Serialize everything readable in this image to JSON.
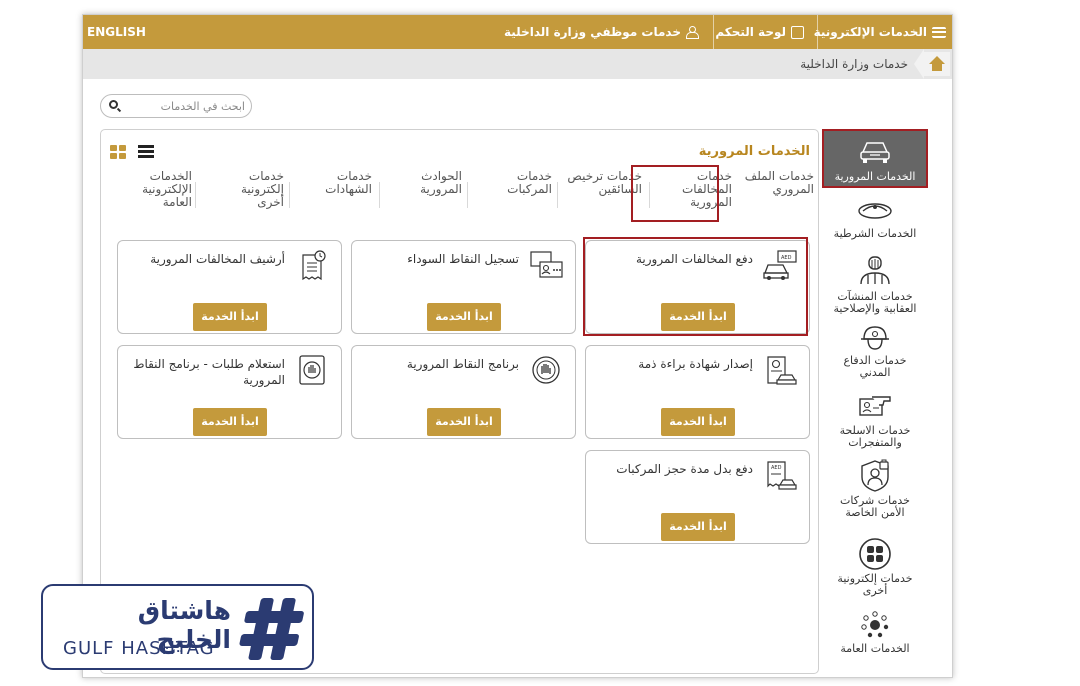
{
  "topbar": {
    "eservices": "الخدمات الإلكترونية",
    "dashboard": "لوحة التحكم",
    "employee_services": "خدمات موظفي وزارة الداخلية",
    "language": "ENGLISH"
  },
  "breadcrumb": {
    "current": "خدمات وزارة الداخلية"
  },
  "search": {
    "placeholder": "ابحث في الخدمات"
  },
  "section": {
    "title": "الخدمات المرورية"
  },
  "tabs": [
    {
      "label": "خدمات الملف\nالمروري"
    },
    {
      "label": "خدمات\nالمخالفات\nالمرورية"
    },
    {
      "label": "خدمات ترخيص\nالسائقين"
    },
    {
      "label": "خدمات\nالمركبات"
    },
    {
      "label": "الحوادث\nالمرورية"
    },
    {
      "label": "خدمات\nالشهادات"
    },
    {
      "label": "خدمات\nإلكترونية\nأخرى"
    },
    {
      "label": "الخدمات\nالإلكترونية\nالعامة"
    }
  ],
  "cards": [
    {
      "title": "دفع المخالفات المرورية",
      "button": "ابدأ الخدمة",
      "icon": "car-fine-icon"
    },
    {
      "title": "تسجيل النقاط السوداء",
      "button": "ابدأ الخدمة",
      "icon": "id-cards-icon"
    },
    {
      "title": "أرشيف المخالفات المرورية",
      "button": "ابدأ الخدمة",
      "icon": "archive-receipt-icon"
    },
    {
      "title": "إصدار شهادة براءة ذمة",
      "button": "ابدأ الخدمة",
      "icon": "clearance-certificate-icon"
    },
    {
      "title": "برنامج النقاط المرورية",
      "button": "ابدأ الخدمة",
      "icon": "hand-points-icon"
    },
    {
      "title": "استعلام طلبات - برنامج النقاط المرورية",
      "button": "ابدأ الخدمة",
      "icon": "inquiry-points-icon"
    },
    {
      "title": "دفع بدل مدة حجز المركبات",
      "button": "ابدأ الخدمة",
      "icon": "impound-fee-icon"
    }
  ],
  "sidebar": [
    {
      "label": "الخدمات المرورية",
      "icon": "car-icon",
      "active": true
    },
    {
      "label": "الخدمات الشرطية",
      "icon": "police-cap-icon"
    },
    {
      "label": "خدمات المنشآت\nالعقابية والإصلاحية",
      "icon": "prison-icon"
    },
    {
      "label": "خدمات الدفاع\nالمدني",
      "icon": "firefighter-icon"
    },
    {
      "label": "خدمات الاسلحة\nوالمتفجرات",
      "icon": "weapons-license-icon"
    },
    {
      "label": "خدمات شركات\nالأمن الخاصة",
      "icon": "security-guard-icon"
    },
    {
      "label": "خدمات إلكترونية\nأخرى",
      "icon": "other-services-icon"
    },
    {
      "label": "الخدمات العامة",
      "icon": "general-services-icon"
    }
  ],
  "watermark": {
    "arabic": "هاشتاق الخليج",
    "english": "GULF HASHTAG"
  },
  "colors": {
    "gold": "#c49a3c",
    "highlight": "#a31e22",
    "sidebar_active": "#666666",
    "watermark": "#2b3b72"
  }
}
